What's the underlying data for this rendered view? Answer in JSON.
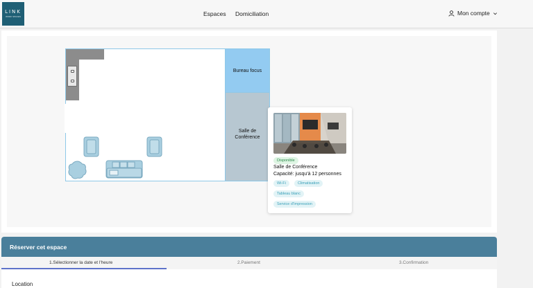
{
  "header": {
    "logo_text": "LINK",
    "logo_subtext": "WORK SPACES",
    "nav": [
      "Espaces",
      "Domiciliation"
    ],
    "account_label": "Mon compte"
  },
  "floorplan": {
    "rooms": [
      {
        "label": "Bureau focus",
        "color": "#93cbf1"
      },
      {
        "label": "Salle de Conférence",
        "color": "#b7c7d1"
      }
    ]
  },
  "popup": {
    "status": "Disponible",
    "title": "Salle de Conférence",
    "capacity": "Capacité: jusqu'à 12 personnes",
    "amenities": [
      "Wi-Fi",
      "Climatisation",
      "Tableau blanc",
      "Service d'Impression"
    ]
  },
  "reservation": {
    "title": "Réserver cet espace",
    "steps": [
      "1.Sélectionner la date et l'heure",
      "2.Paiement",
      "3.Confirmation"
    ],
    "active_step": 1,
    "field_label": "Location"
  },
  "colors": {
    "accent": "#4a7f9b",
    "logo_bg": "#1f5f75",
    "step_active": "#5d72c9"
  }
}
